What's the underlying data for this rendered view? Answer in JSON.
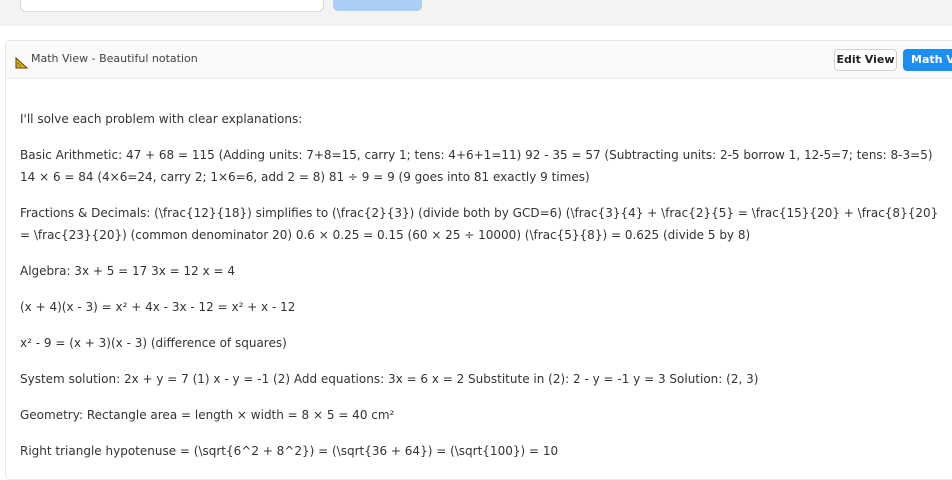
{
  "panel": {
    "title": "Math View - Beautiful notation",
    "edit_label": "Edit View",
    "math_label": "Math View"
  },
  "content": {
    "intro": "I'll solve each problem with clear explanations:",
    "arithmetic": "Basic Arithmetic: 47 + 68 = 115 (Adding units: 7+8=15, carry 1; tens: 4+6+1=11) 92 - 35 = 57 (Subtracting units: 2-5 borrow 1, 12-5=7; tens: 8-3=5) 14 × 6 = 84 (4×6=24, carry 2; 1×6=6, add 2 = 8) 81 ÷ 9 = 9 (9 goes into 81 exactly 9 times)",
    "fractions": "Fractions & Decimals: (\\frac{12}{18}) simplifies to (\\frac{2}{3}) (divide both by GCD=6) (\\frac{3}{4} + \\frac{2}{5} = \\frac{15}{20} + \\frac{8}{20} = \\frac{23}{20}) (common denominator 20) 0.6 × 0.25 = 0.15 (60 × 25 ÷ 10000) (\\frac{5}{8}) = 0.625 (divide 5 by 8)",
    "algebra": "Algebra: 3x + 5 = 17 3x = 12 x = 4",
    "expand": "(x + 4)(x - 3) = x² + 4x - 3x - 12 = x² + x - 12",
    "factor": "x² - 9 = (x + 3)(x - 3) (difference of squares)",
    "system": "System solution: 2x + y = 7 (1) x - y = -1 (2) Add equations: 3x = 6 x = 2 Substitute in (2): 2 - y = -1 y = 3 Solution: (2, 3)",
    "geometry": "Geometry: Rectangle area = length × width = 8 × 5 = 40 cm²",
    "hypotenuse": "Right triangle hypotenuse = (\\sqrt{6^2 + 8^2}) = (\\sqrt{36 + 64}) = (\\sqrt{100}) = 10"
  },
  "icons": {
    "panel_icon": "ruler-triangle-icon"
  },
  "colors": {
    "accent": "#1e8ef0",
    "accent_disabled": "#a9cff5"
  }
}
